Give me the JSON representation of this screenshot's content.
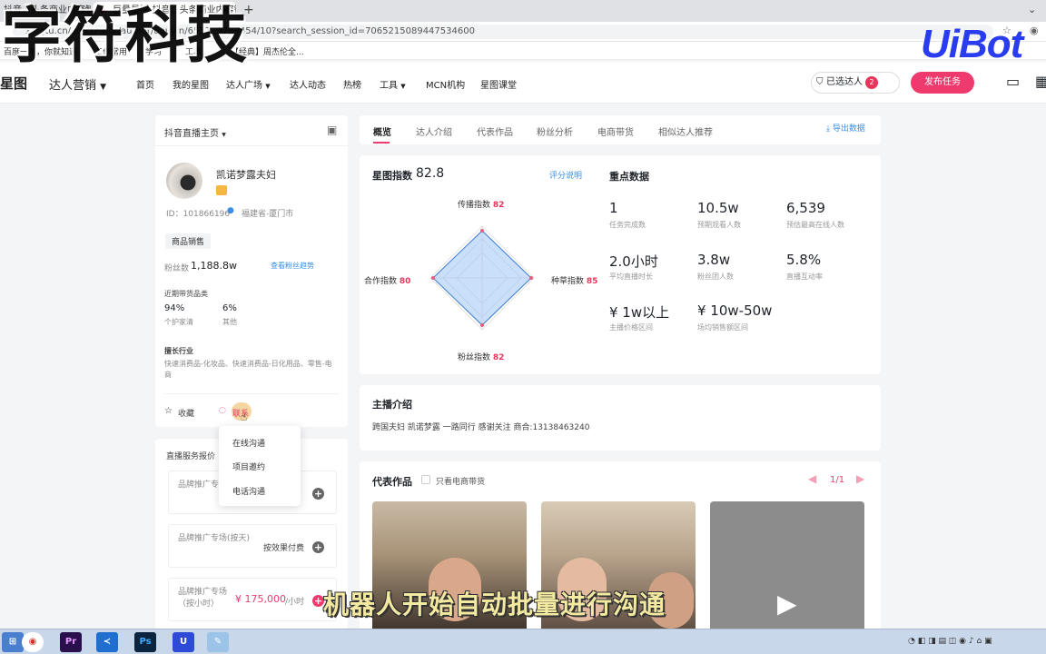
{
  "browser": {
    "tab1_title": "抖音、头条商业内容智",
    "tab2_title": "巨量星图-抖音、头条商业内容智",
    "url": "xingtu.cn/ad/creator/author/douyin/6553..9789454/10?search_session_id=7065215089447534600",
    "bookmarks": [
      "百度一下，你就知道",
      "工作常用",
      "学习",
      "工具",
      "【经典】周杰伦全..."
    ]
  },
  "watermark": {
    "text": "字符科技",
    "logo": "UiBot"
  },
  "header": {
    "logo": "星图",
    "marketing": "达人营销",
    "nav": [
      "首页",
      "我的星图",
      "达人广场",
      "达人动态",
      "热榜",
      "工具",
      "MCN机构",
      "星图课堂"
    ],
    "cart_label": "已选达人",
    "cart_count": "2",
    "publish_label": "发布任务"
  },
  "profile": {
    "section_title": "抖音直播主页",
    "name": "凯诺梦露夫妇",
    "id_text": "ID：101866196",
    "location": "福建省-厦门市",
    "tag": "商品销售",
    "fans_label": "粉丝数",
    "fans_value": "1,188.8w",
    "fans_trend": "查看粉丝趋势",
    "category_title": "近期带货品类",
    "categories": [
      {
        "pct": "94%",
        "name": "个护家清"
      },
      {
        "pct": "6%",
        "name": "其他"
      }
    ],
    "industry_title": "擅长行业",
    "industry_text": "快速消费品-化妆品、快速消费品-日化用品、零售-电商",
    "favorite": "收藏",
    "contact": "联系"
  },
  "popup": {
    "items": [
      "在线沟通",
      "项目邀约",
      "电话沟通"
    ]
  },
  "services": {
    "title": "直播服务报价",
    "items": [
      {
        "name": "品牌推广专场（按小时）",
        "price": ""
      },
      {
        "name": "品牌推广专场(按天)",
        "price": "按效果付费"
      },
      {
        "name": "品牌推广专场（按小时）",
        "price": "¥ 175,000",
        "unit": "/小时"
      }
    ]
  },
  "tabs": {
    "items": [
      "概览",
      "达人介绍",
      "代表作品",
      "粉丝分析",
      "电商带货",
      "相似达人推荐"
    ],
    "export": "导出数据"
  },
  "overview": {
    "star_label": "星图指数",
    "star_value": "82.8",
    "rating_link": "评分说明",
    "radar": [
      {
        "label": "传播指数",
        "value": "82"
      },
      {
        "label": "种草指数",
        "value": "85"
      },
      {
        "label": "粉丝指数",
        "value": "82"
      },
      {
        "label": "合作指数",
        "value": "80"
      }
    ],
    "key_title": "重点数据",
    "metrics": [
      {
        "value": "1",
        "label": "任务完成数"
      },
      {
        "value": "10.5w",
        "label": "预期观看人数"
      },
      {
        "value": "6,539",
        "label": "预估最高在线人数"
      },
      {
        "value": "2.0小时",
        "label": "平均直播时长"
      },
      {
        "value": "3.8w",
        "label": "粉丝团人数"
      },
      {
        "value": "5.8%",
        "label": "直播互动率"
      },
      {
        "value": "¥ 1w以上",
        "label": "主播价格区间"
      },
      {
        "value": "¥ 10w-50w",
        "label": "场均销售额区间"
      }
    ]
  },
  "intro": {
    "title": "主播介绍",
    "text": "跨国夫妇 凯诺梦露 一路同行 感谢关注 商合:13138463240"
  },
  "works": {
    "title": "代表作品",
    "filter": "只看电商带货",
    "page": "1/1"
  },
  "subtitle": "机器人开始自动批量进行沟通",
  "colors": {
    "accent": "#ee3a6d",
    "link": "#3a8ee6",
    "radar_fill": "#9ec5f5"
  }
}
